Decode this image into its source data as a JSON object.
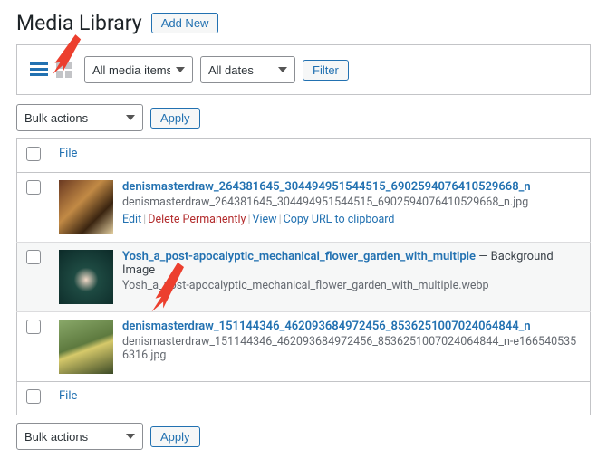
{
  "header": {
    "title": "Media Library",
    "add_new": "Add New"
  },
  "toolbar": {
    "media_filter": "All media items",
    "date_filter": "All dates",
    "filter_btn": "Filter"
  },
  "bulk": {
    "label": "Bulk actions",
    "apply": "Apply"
  },
  "columns": {
    "file": "File"
  },
  "row_actions": {
    "edit": "Edit",
    "delete": "Delete Permanently",
    "view": "View",
    "copy": "Copy URL to clipboard"
  },
  "items": [
    {
      "title": "denismasterdraw_264381645_304494951544515_6902594076410529668_n",
      "suffix": "",
      "filename": "denismasterdraw_264381645_304494951544515_6902594076410529668_n.jpg",
      "show_actions": true,
      "thumb_class": "t1"
    },
    {
      "title": "Yosh_a_post-apocalyptic_mechanical_flower_garden_with_multiple",
      "suffix": " — Background Image",
      "filename": "Yosh_a_post-apocalyptic_mechanical_flower_garden_with_multiple.webp",
      "show_actions": false,
      "thumb_class": "t2"
    },
    {
      "title": "denismasterdraw_151144346_462093684972456_8536251007024064844_n",
      "suffix": "",
      "filename": "denismasterdraw_151144346_462093684972456_8536251007024064844_n-e1665405356316.jpg",
      "show_actions": false,
      "thumb_class": "t3"
    }
  ]
}
